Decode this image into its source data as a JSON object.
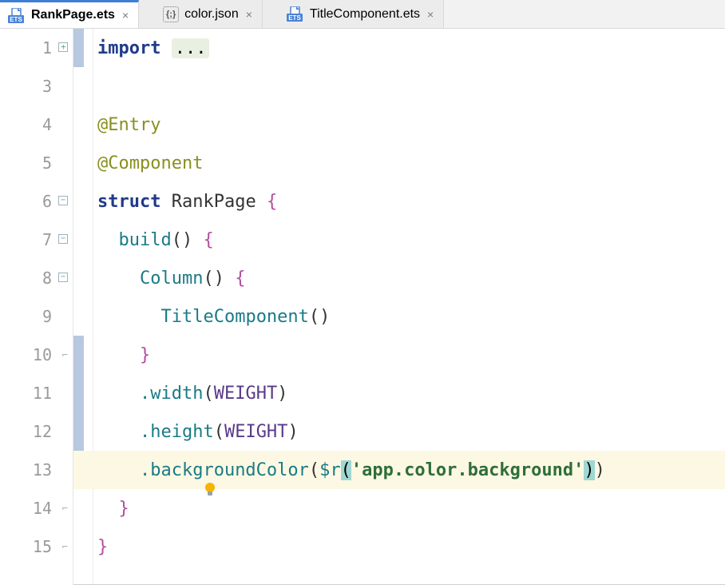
{
  "tabs": [
    {
      "name": "RankPage.ets",
      "icon": "ets",
      "active": true
    },
    {
      "name": "color.json",
      "icon": "json",
      "active": false
    },
    {
      "name": "TitleComponent.ets",
      "icon": "ets",
      "active": false
    }
  ],
  "ets_badge": "ETS",
  "json_badge": "{;}",
  "close_glyph": "×",
  "gutter": {
    "numbers": [
      "1",
      "3",
      "4",
      "5",
      "6",
      "7",
      "8",
      "9",
      "10",
      "11",
      "12",
      "13",
      "14",
      "15"
    ]
  },
  "code": {
    "import_kw": "import",
    "folded": "...",
    "entry": "@Entry",
    "component": "@Component",
    "struct_kw": "struct",
    "page_name": "RankPage",
    "lbrace": "{",
    "rbrace": "}",
    "build": "build",
    "parens": "()",
    "column": "Column",
    "titlecomp": "TitleComponent",
    "width": ".width",
    "height": ".height",
    "weight": "WEIGHT",
    "bgcolor": ".backgroundColor",
    "r_fn": "$r",
    "lparen": "(",
    "rparen": ")",
    "str_open": "'",
    "str_body": "app.color.background",
    "str_close": "'"
  }
}
